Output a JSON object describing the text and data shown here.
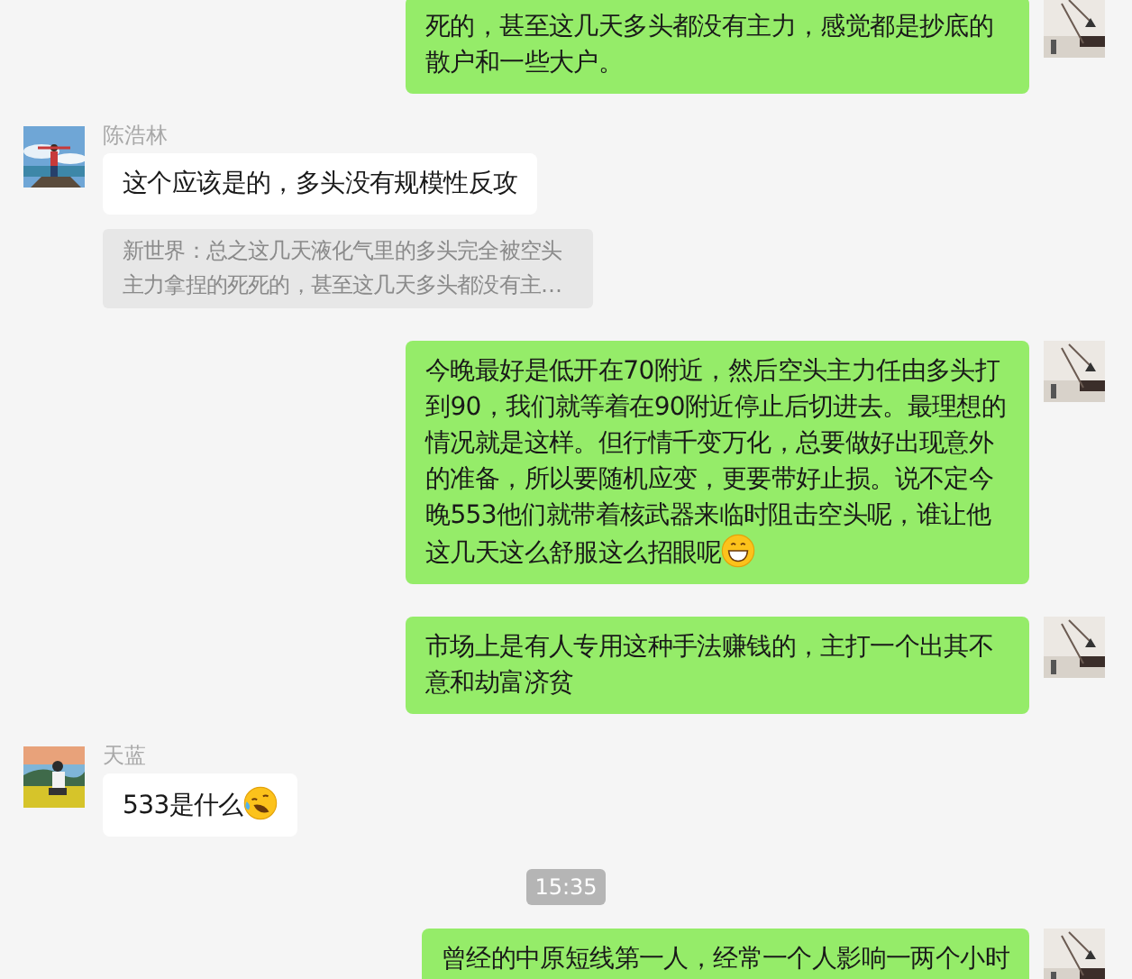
{
  "messages": [
    {
      "kind": "sent",
      "text": "死的，甚至这几天多头都没有主力，感觉都是抄底的散户和一些大户。"
    },
    {
      "kind": "received",
      "name": "陈浩林",
      "text": "这个应该是的，多头没有规模性反攻",
      "quote": "新世界：总之这几天液化气里的多头完全被空头主力拿捏的死死的，甚至这几天多头都没有主…"
    },
    {
      "kind": "sent",
      "text": "今晚最好是低开在70附近，然后空头主力任由多头打到90，我们就等着在90附近停止后切进去。最理想的情况就是这样。但行情千变万化，总要做好出现意外的准备，所以要随机应变，更要带好止损。说不定今晚553他们就带着核武器来临时阻击空头呢，谁让他这几天这么舒服这么招眼呢",
      "emoji": {
        "kind": "grin"
      }
    },
    {
      "kind": "sent",
      "text": "市场上是有人专用这种手法赚钱的，主打一个出其不意和劫富济贫"
    },
    {
      "kind": "received",
      "name": "天蓝",
      "text": "533是什么",
      "emoji": {
        "kind": "tears"
      }
    },
    {
      "kind": "time",
      "text": "15:35"
    },
    {
      "kind": "sent",
      "text": "曾经的中原短线第一人，经常一个人影响一两个小时"
    }
  ]
}
